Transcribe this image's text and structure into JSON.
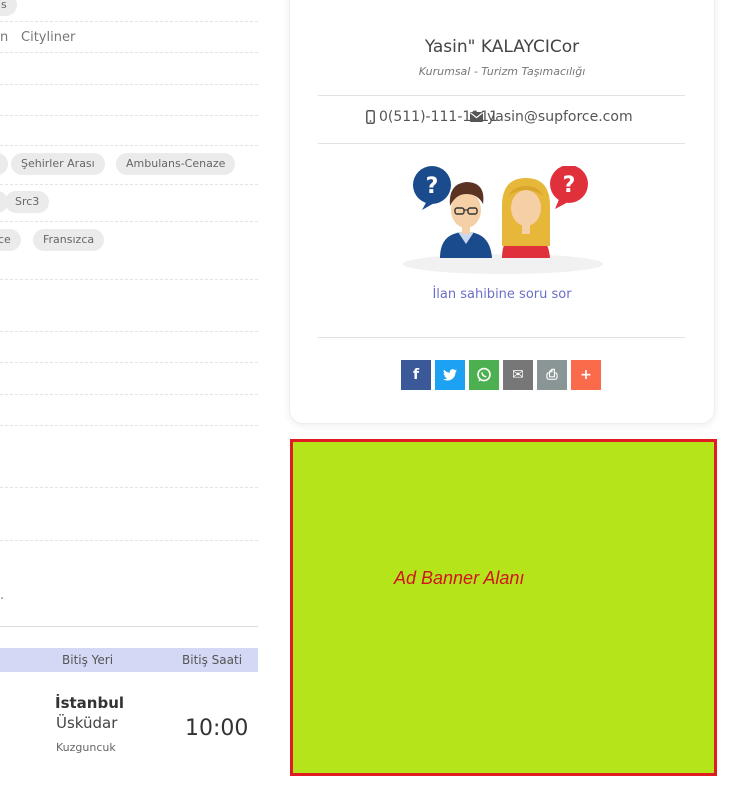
{
  "left_panel": {
    "row1_tag": "ıs",
    "row2_text_a": "n",
    "row2_text_b": "Cityliner",
    "row5_tags": [
      "",
      "Şehirler Arası",
      "Ambulans-Cenaze"
    ],
    "row6_tags": [
      "",
      "Src3"
    ],
    "row7_tags": [
      "ce",
      "Fransızca"
    ],
    "lone_dot": "."
  },
  "table": {
    "headers": [
      "Bitiş Yeri",
      "Bitiş Saati"
    ],
    "row": {
      "city": "İstanbul",
      "district": "Üsküdar",
      "neighborhood": "Kuzguncuk",
      "end_time": "10:00"
    }
  },
  "owner_card": {
    "name": "Yasin\" KALAYCICor",
    "role": "Kurumsal - Turizm Taşımacılığı",
    "phone": "0(511)-111-1111",
    "email": "yasin@supforce.com",
    "ask_link": "İlan sahibine soru sor",
    "share_buttons": [
      {
        "name": "facebook",
        "glyph": "f",
        "color": "#3b5998"
      },
      {
        "name": "twitter",
        "glyph": "t",
        "color": "#1da1f2"
      },
      {
        "name": "whatsapp",
        "glyph": "w",
        "color": "#4caf50"
      },
      {
        "name": "email",
        "glyph": "✉",
        "color": "#777777"
      },
      {
        "name": "print",
        "glyph": "⎙",
        "color": "#8a9696"
      },
      {
        "name": "more",
        "glyph": "+",
        "color": "#fa6b4b"
      }
    ]
  },
  "ad_banner": {
    "text": "Ad Banner Alanı",
    "background": "#b5e41a",
    "border": "#e11b22"
  }
}
